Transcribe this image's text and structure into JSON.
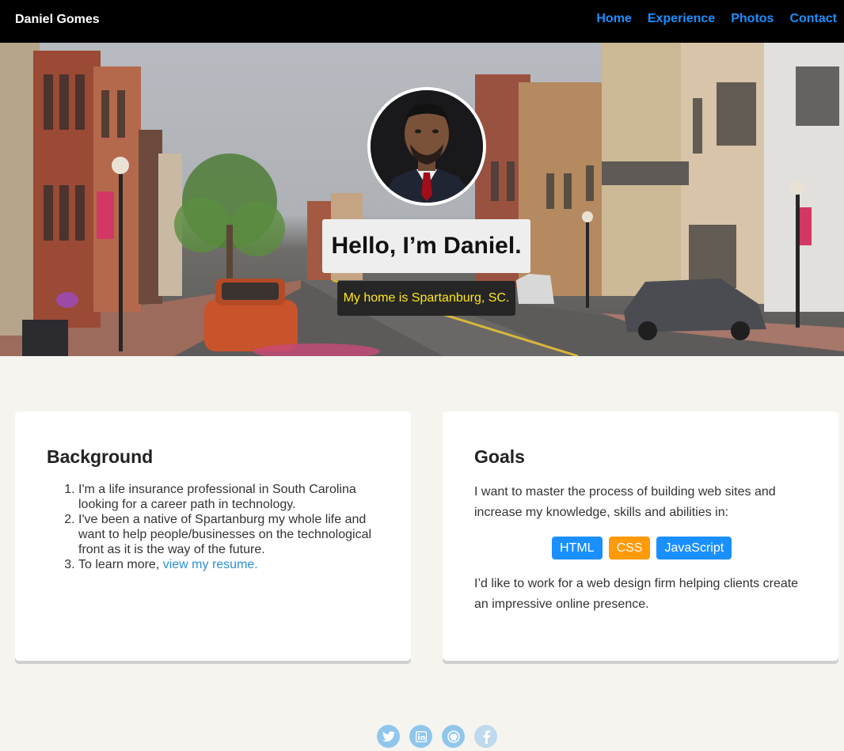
{
  "nav": {
    "brand": "Daniel Gomes",
    "links": [
      "Home",
      "Experience",
      "Photos",
      "Contact"
    ]
  },
  "hero": {
    "greeting": "Hello, I’m Daniel.",
    "location": "My home is Spartanburg, SC."
  },
  "background": {
    "title": "Background",
    "items": [
      "I'm a life insurance professional in South Carolina looking for a career path in technology.",
      "I've been a native of Spartanburg my whole life and want to help people/businesses on the technological front as it is the way of the future."
    ],
    "item3_prefix": "To learn more, ",
    "resume_link": "view my resume."
  },
  "goals": {
    "title": "Goals",
    "intro": "I want to master the process of building web sites and increase my knowledge, skills and abilities in:",
    "tags": [
      {
        "label": "HTML",
        "color": "#1a8fff"
      },
      {
        "label": "CSS",
        "color": "#ff9a0a"
      },
      {
        "label": "JavaScript",
        "color": "#1a8fff"
      }
    ],
    "outro": "I’d like to work for a web design firm helping clients create an impressive online presence."
  },
  "social": [
    "twitter-icon",
    "linkedin-icon",
    "github-icon",
    "facebook-icon"
  ],
  "colors": {
    "nav_bg": "#000000",
    "link": "#1a8fff",
    "page_bg": "#f5f4ef",
    "location_text": "#ffe81a",
    "social_icon_bg": "#8fc6ec"
  }
}
